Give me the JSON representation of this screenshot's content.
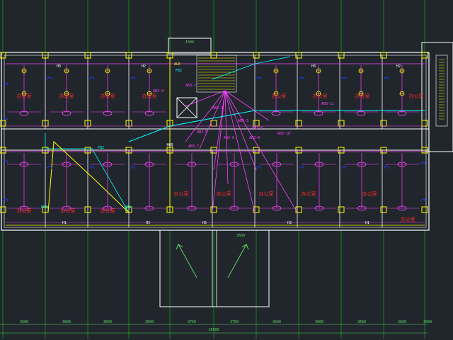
{
  "colors": {
    "background": "#21262d",
    "wall": "#ffffff",
    "grid_line": "#00c800",
    "column": "#ffff00",
    "circuit": "#ff40ff",
    "fixture": "#ffff00",
    "room_label": "#ff2828",
    "conduit": "#00ffff",
    "socket": "#1e3cff"
  },
  "plan": {
    "top_dim": "1500",
    "stair_dim": "3600",
    "total_dim": "26000",
    "bottom_dims": [
      "3600",
      "3600",
      "3600",
      "3600",
      "3750",
      "3750",
      "3600",
      "3600",
      "3600",
      "3600",
      "3600"
    ],
    "circuit_labels_top": [
      "H3",
      "H2",
      "H3",
      "H2"
    ],
    "circuit_labels_bottom": [
      "H1",
      "H3",
      "H5",
      "H3",
      "H1"
    ],
    "rooms_top": [
      "办公室",
      "办公室",
      "办公室",
      "办公室",
      "办公室",
      "办公室",
      "办公室",
      "办公室"
    ],
    "rooms_bottom": [
      "办公室",
      "办公室",
      "办公室",
      "办公室",
      "办公室",
      "办公室",
      "办公室",
      "办公室",
      "办公室"
    ],
    "panel_tags": [
      "AB3-4",
      "AB3-1",
      "AB3-2",
      "AB3-3",
      "AB3-5",
      "AB3-8",
      "AB3-6",
      "AB3-7",
      "AB3-9",
      "AB3-10",
      "AB3-11"
    ],
    "cyan_tags": [
      "FB2",
      "FB2",
      "FB2",
      "FB2"
    ],
    "corridor_tag": "H6Q",
    "stair_tag": "ALE"
  }
}
